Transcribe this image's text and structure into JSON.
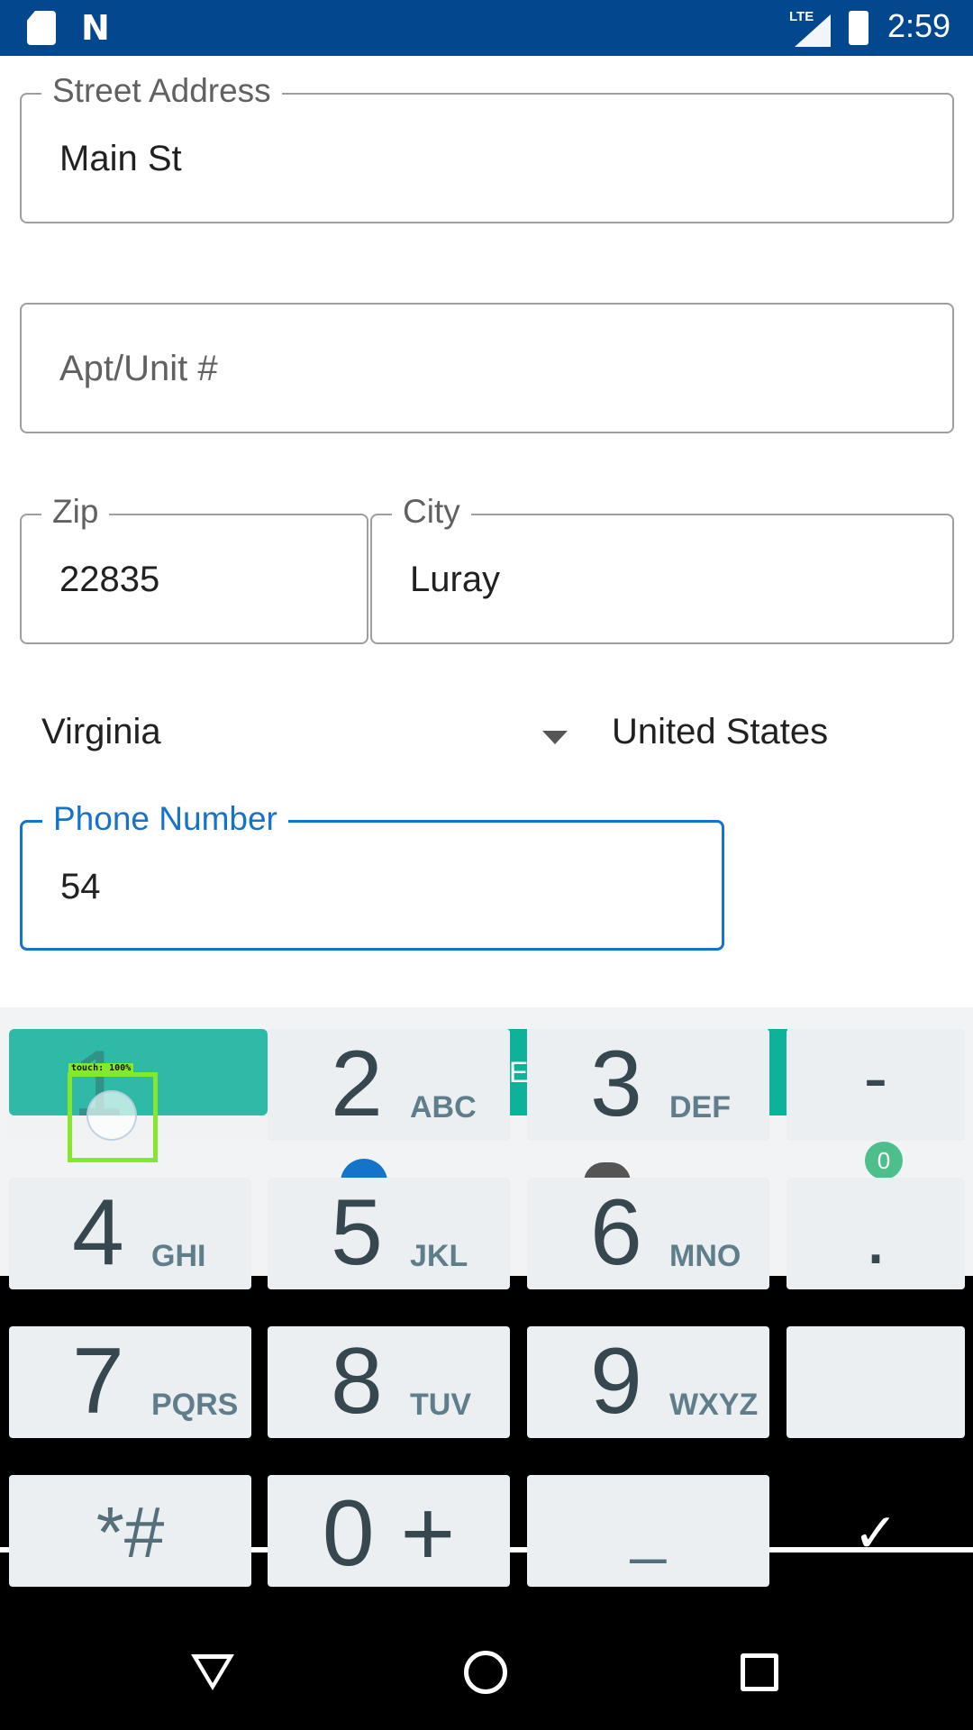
{
  "status_bar": {
    "network": "LTE",
    "time": "2:59"
  },
  "form": {
    "street": {
      "label": "Street Address",
      "value": "Main St"
    },
    "apt": {
      "placeholder": "Apt/Unit #"
    },
    "zip": {
      "label": "Zip",
      "value": "22835"
    },
    "city": {
      "label": "City",
      "value": "Luray"
    },
    "state": {
      "value": "Virginia"
    },
    "country": {
      "value": "United States"
    },
    "phone": {
      "label": "Phone Number",
      "value": "54"
    }
  },
  "behind": {
    "cart_count": "0",
    "partial_letter": "E"
  },
  "keypad": {
    "keys": [
      {
        "num": "1",
        "letters": ""
      },
      {
        "num": "2",
        "letters": "ABC"
      },
      {
        "num": "3",
        "letters": "DEF"
      },
      {
        "num": "-",
        "letters": ""
      },
      {
        "num": "4",
        "letters": "GHI"
      },
      {
        "num": "5",
        "letters": "JKL"
      },
      {
        "num": "6",
        "letters": "MNO"
      },
      {
        "num": ".",
        "letters": ""
      },
      {
        "num": "7",
        "letters": "PQRS"
      },
      {
        "num": "8",
        "letters": "TUV"
      },
      {
        "num": "9",
        "letters": "WXYZ"
      },
      {
        "num": "*#",
        "letters": ""
      },
      {
        "num": "0 +",
        "letters": ""
      },
      {
        "num": "_",
        "letters": ""
      },
      {
        "num": "✓",
        "letters": ""
      }
    ]
  },
  "overlay": {
    "touch_label": "touch: 100%"
  },
  "colors": {
    "status_bar": "#03478f",
    "accent": "#1573c9",
    "teal": "#0fb19a",
    "key_bg": "#eceff1"
  }
}
